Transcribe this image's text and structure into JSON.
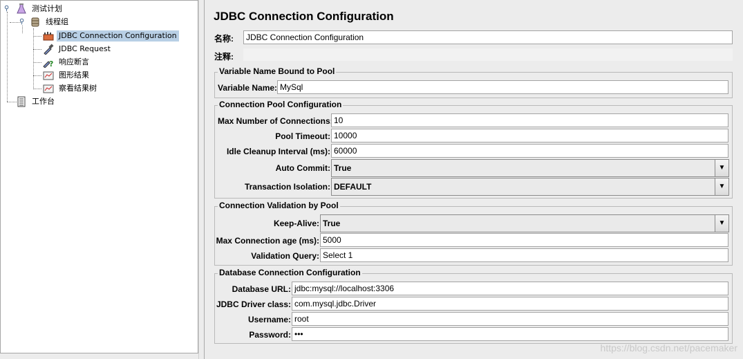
{
  "tree": {
    "items": [
      {
        "label": "测试计划",
        "icon": "flask-icon"
      },
      {
        "label": "线程组",
        "icon": "spool-icon"
      },
      {
        "label": "JDBC Connection Configuration",
        "icon": "jdbc-config-icon"
      },
      {
        "label": "JDBC Request",
        "icon": "pipette-icon"
      },
      {
        "label": "响应断言",
        "icon": "assertion-icon"
      },
      {
        "label": "图形结果",
        "icon": "graph-icon"
      },
      {
        "label": "察看结果树",
        "icon": "graph-icon"
      },
      {
        "label": "工作台",
        "icon": "workbench-icon"
      }
    ]
  },
  "panel": {
    "title": "JDBC Connection Configuration",
    "name_label": "名称:",
    "name_value": "JDBC Connection Configuration",
    "comment_label": "注释:",
    "comment_value": ""
  },
  "var_group": {
    "title": "Variable Name Bound to Pool",
    "label": "Variable Name:",
    "value": "MySql"
  },
  "pool_group": {
    "title": "Connection Pool Configuration",
    "max_conn_label": "Max Number of Connections:",
    "max_conn_value": "10",
    "timeout_label": "Pool Timeout:",
    "timeout_value": "10000",
    "idle_label": "Idle Cleanup Interval (ms):",
    "idle_value": "60000",
    "autocommit_label": "Auto Commit:",
    "autocommit_value": "True",
    "isolation_label": "Transaction Isolation:",
    "isolation_value": "DEFAULT"
  },
  "validation_group": {
    "title": "Connection Validation by Pool",
    "keepalive_label": "Keep-Alive:",
    "keepalive_value": "True",
    "maxage_label": "Max Connection age (ms):",
    "maxage_value": "5000",
    "query_label": "Validation Query:",
    "query_value": "Select 1"
  },
  "db_group": {
    "title": "Database Connection Configuration",
    "url_label": "Database URL:",
    "url_value": "jdbc:mysql://localhost:3306",
    "driver_label": "JDBC Driver class:",
    "driver_value": "com.mysql.jdbc.Driver",
    "user_label": "Username:",
    "user_value": "root",
    "pass_label": "Password:",
    "pass_value": "•••"
  },
  "watermark": "https://blog.csdn.net/pacemaker",
  "colors": {
    "selection": "#b8cfe5",
    "panel_bg": "#ececec"
  }
}
